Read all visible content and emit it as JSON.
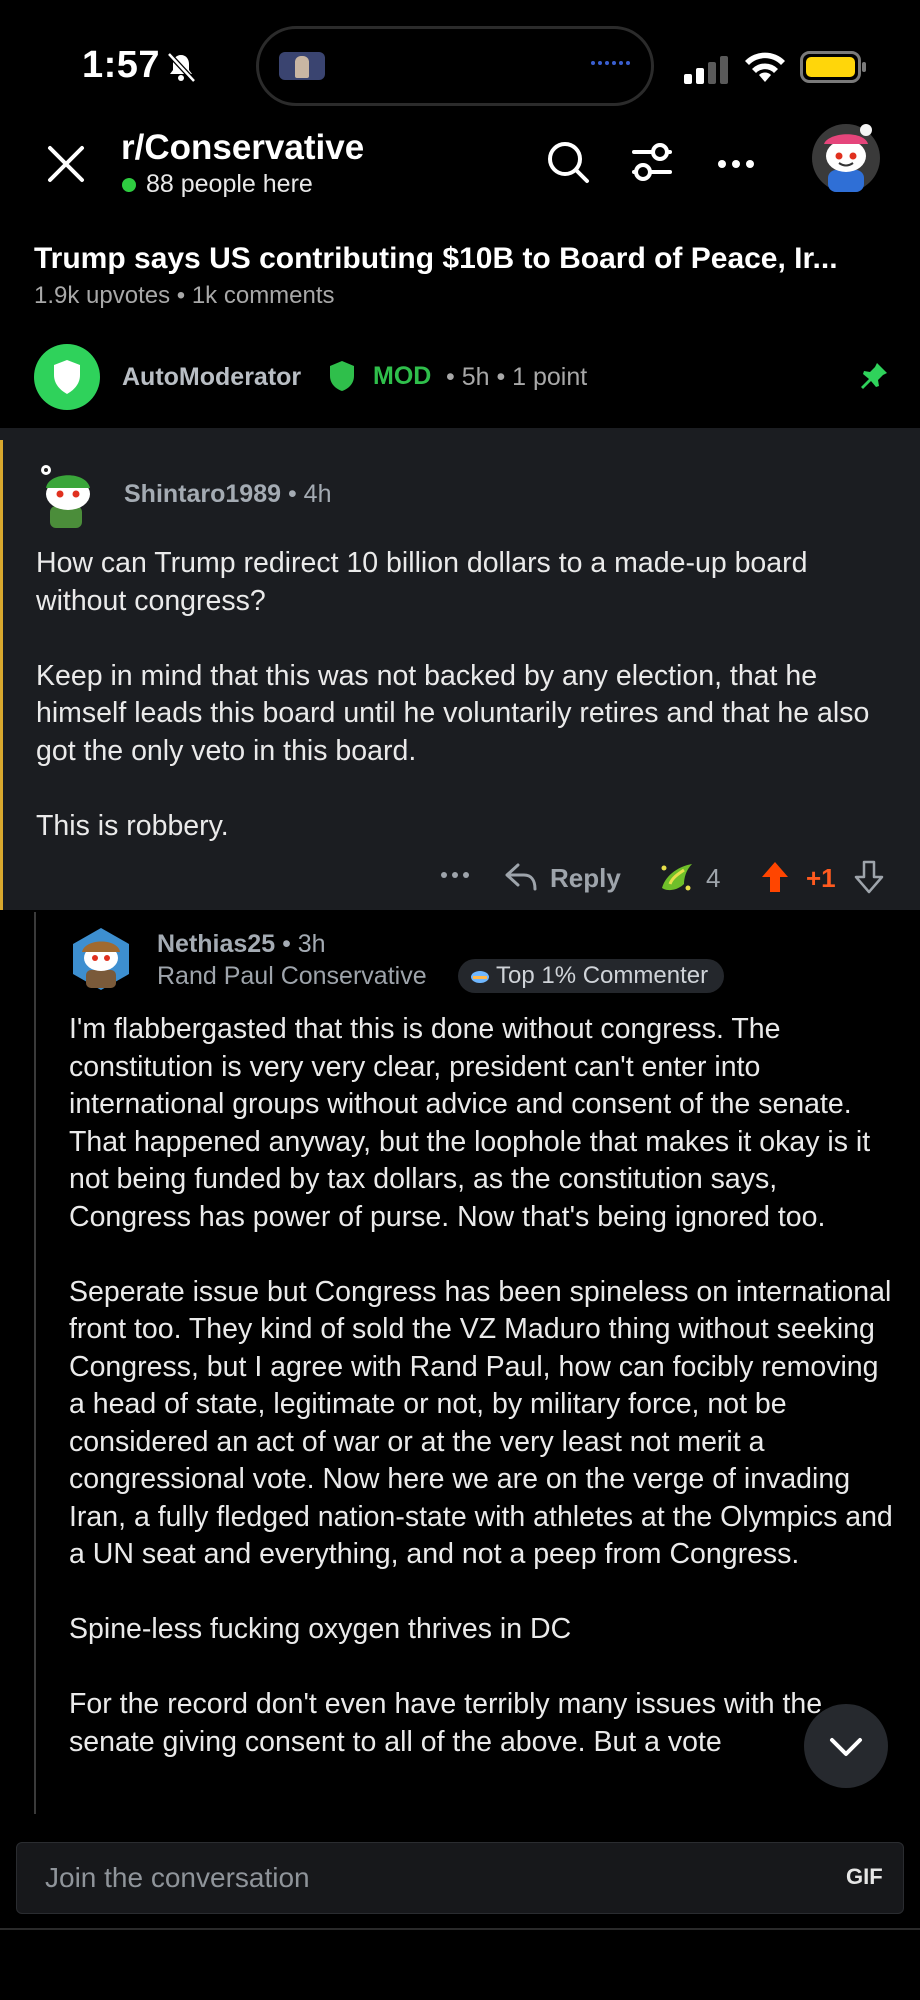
{
  "status_bar": {
    "time": "1:57"
  },
  "header": {
    "subreddit": "r/Conservative",
    "online": "88 people here"
  },
  "post": {
    "title": "Trump says US contributing $10B to Board of Peace, Ir...",
    "meta": "1.9k upvotes • 1k comments"
  },
  "automod": {
    "name": "AutoModerator",
    "badge": "MOD",
    "meta": "• 5h • 1 point"
  },
  "comment1": {
    "author": "Shintaro1989",
    "age": "• 4h",
    "paragraphs": [
      "How can Trump redirect 10 billion dollars to a made-up board without congress?",
      "Keep in mind that this was not backed by any election, that he himself leads this board until he voluntarily retires and that he also got the only veto in this board.",
      "This is robbery."
    ],
    "reply_label": "Reply",
    "award_count": "4",
    "score": "+1"
  },
  "comment2": {
    "author": "Nethias25",
    "age": "• 3h",
    "flair": "Rand Paul Conservative",
    "badge": "Top 1% Commenter",
    "paragraphs": [
      "I'm flabbergasted that this is done without congress. The constitution is very very clear, president can't enter into international groups without advice and consent of the senate. That happened anyway, but the loophole that makes it okay is it not being funded by tax dollars, as the constitution says, Congress has power of purse. Now that's being ignored too.",
      "Seperate issue but Congress has been spineless on international front too. They kind of sold the VZ Maduro thing without seeking Congress, but I agree with Rand Paul, how can focibly removing a head of state, legitimate or not, by military force, not be considered an act of war or at the very least not merit a congressional vote. Now here we are on the verge of invading Iran, a fully fledged nation-state with athletes at the Olympics and a UN seat and everything, and not a peep from Congress.",
      "Spine-less fucking oxygen thrives in DC",
      "For the record don't even have terribly many issues with the senate giving consent to all of the above. But a vote"
    ]
  },
  "composer": {
    "placeholder": "Join the conversation",
    "gif_label": "GIF"
  },
  "colors": {
    "online": "#2ecc40",
    "mod_green": "#2fbf4b",
    "upvote": "#ff5a1f",
    "highlight_bar": "#d9a82e",
    "battery": "#ffd60a"
  },
  "icons": [
    "close-icon",
    "search-icon",
    "filter-icon",
    "more-icon",
    "pin-icon",
    "reply-icon",
    "award-icon",
    "upvote-icon",
    "downvote-icon",
    "chevron-down-icon"
  ]
}
